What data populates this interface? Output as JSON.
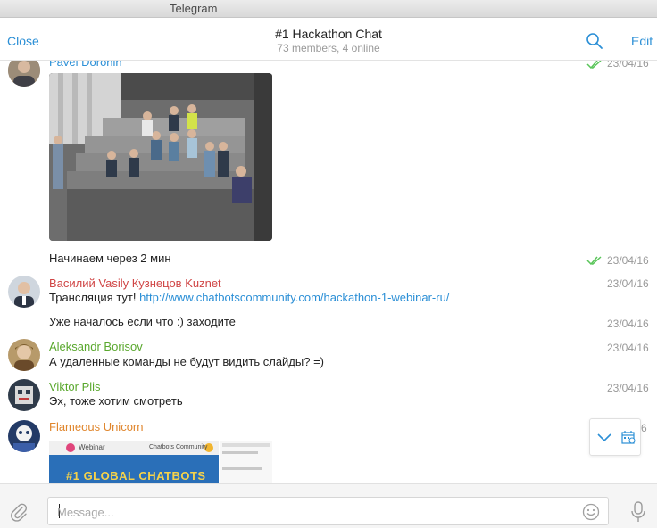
{
  "window": {
    "title": "Telegram"
  },
  "header": {
    "close_label": "Close",
    "chat_title": "#1 Hackathon Chat",
    "chat_subtitle": "73 members, 4 online",
    "edit_label": "Edit",
    "search_icon": "search-icon"
  },
  "colors": {
    "accent": "#2b8fd6",
    "tick": "#5ac55a",
    "timestamp": "#999999"
  },
  "messages": [
    {
      "author": "Pavel Doronin",
      "author_color": "#2b8fd6",
      "time": "23/04/16",
      "attachment": "photo",
      "read_ticks": true
    },
    {
      "text": "Начинаем через 2 мин",
      "time": "23/04/16",
      "read_ticks": true
    },
    {
      "author": "Василий Vasily Кузнецов Kuznet",
      "author_color": "#d04545",
      "text_prefix": "Трансляция тут! ",
      "link": "http://www.chatbotscommunity.com/hackathon-1-webinar-ru/",
      "time": "23/04/16"
    },
    {
      "text": "Уже началось если что :) заходите",
      "time": "23/04/16"
    },
    {
      "author": "Aleksandr Borisov",
      "author_color": "#5aa82e",
      "text": "А удаленные команды не будут видить слайды? =)",
      "time": "23/04/16"
    },
    {
      "author": "Viktor Plis",
      "author_color": "#5aa82e",
      "text": "Эх, тоже хотим смотреть",
      "time": "23/04/16"
    },
    {
      "author": "Flameous Unicorn",
      "author_color": "#e0862d",
      "time_partial": "6",
      "attachment": "screenshot",
      "screenshot_text": {
        "webinar": "Webinar",
        "community": "Chatbots Community",
        "banner": "#1 GLOBAL CHATBOTS"
      }
    }
  ],
  "scroll_widget": {
    "icons": [
      "chevron-down-icon",
      "calendar-icon"
    ]
  },
  "composer": {
    "placeholder": "Message...",
    "value": ""
  }
}
